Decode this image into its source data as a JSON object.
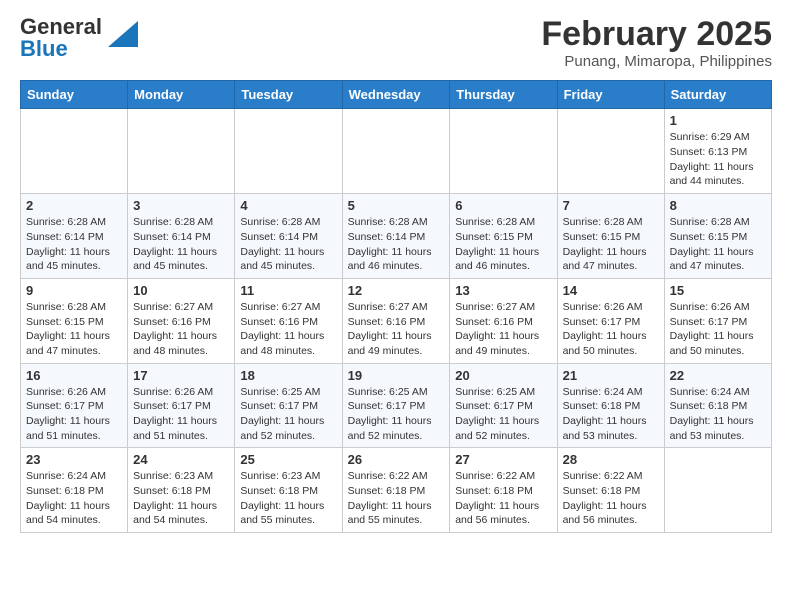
{
  "header": {
    "logo_general": "General",
    "logo_blue": "Blue",
    "title": "February 2025",
    "subtitle": "Punang, Mimaropa, Philippines"
  },
  "days_of_week": [
    "Sunday",
    "Monday",
    "Tuesday",
    "Wednesday",
    "Thursday",
    "Friday",
    "Saturday"
  ],
  "weeks": [
    {
      "days": [
        {
          "num": "",
          "info": ""
        },
        {
          "num": "",
          "info": ""
        },
        {
          "num": "",
          "info": ""
        },
        {
          "num": "",
          "info": ""
        },
        {
          "num": "",
          "info": ""
        },
        {
          "num": "",
          "info": ""
        },
        {
          "num": "1",
          "info": "Sunrise: 6:29 AM\nSunset: 6:13 PM\nDaylight: 11 hours\nand 44 minutes."
        }
      ]
    },
    {
      "days": [
        {
          "num": "2",
          "info": "Sunrise: 6:28 AM\nSunset: 6:14 PM\nDaylight: 11 hours\nand 45 minutes."
        },
        {
          "num": "3",
          "info": "Sunrise: 6:28 AM\nSunset: 6:14 PM\nDaylight: 11 hours\nand 45 minutes."
        },
        {
          "num": "4",
          "info": "Sunrise: 6:28 AM\nSunset: 6:14 PM\nDaylight: 11 hours\nand 45 minutes."
        },
        {
          "num": "5",
          "info": "Sunrise: 6:28 AM\nSunset: 6:14 PM\nDaylight: 11 hours\nand 46 minutes."
        },
        {
          "num": "6",
          "info": "Sunrise: 6:28 AM\nSunset: 6:15 PM\nDaylight: 11 hours\nand 46 minutes."
        },
        {
          "num": "7",
          "info": "Sunrise: 6:28 AM\nSunset: 6:15 PM\nDaylight: 11 hours\nand 47 minutes."
        },
        {
          "num": "8",
          "info": "Sunrise: 6:28 AM\nSunset: 6:15 PM\nDaylight: 11 hours\nand 47 minutes."
        }
      ]
    },
    {
      "days": [
        {
          "num": "9",
          "info": "Sunrise: 6:28 AM\nSunset: 6:15 PM\nDaylight: 11 hours\nand 47 minutes."
        },
        {
          "num": "10",
          "info": "Sunrise: 6:27 AM\nSunset: 6:16 PM\nDaylight: 11 hours\nand 48 minutes."
        },
        {
          "num": "11",
          "info": "Sunrise: 6:27 AM\nSunset: 6:16 PM\nDaylight: 11 hours\nand 48 minutes."
        },
        {
          "num": "12",
          "info": "Sunrise: 6:27 AM\nSunset: 6:16 PM\nDaylight: 11 hours\nand 49 minutes."
        },
        {
          "num": "13",
          "info": "Sunrise: 6:27 AM\nSunset: 6:16 PM\nDaylight: 11 hours\nand 49 minutes."
        },
        {
          "num": "14",
          "info": "Sunrise: 6:26 AM\nSunset: 6:17 PM\nDaylight: 11 hours\nand 50 minutes."
        },
        {
          "num": "15",
          "info": "Sunrise: 6:26 AM\nSunset: 6:17 PM\nDaylight: 11 hours\nand 50 minutes."
        }
      ]
    },
    {
      "days": [
        {
          "num": "16",
          "info": "Sunrise: 6:26 AM\nSunset: 6:17 PM\nDaylight: 11 hours\nand 51 minutes."
        },
        {
          "num": "17",
          "info": "Sunrise: 6:26 AM\nSunset: 6:17 PM\nDaylight: 11 hours\nand 51 minutes."
        },
        {
          "num": "18",
          "info": "Sunrise: 6:25 AM\nSunset: 6:17 PM\nDaylight: 11 hours\nand 52 minutes."
        },
        {
          "num": "19",
          "info": "Sunrise: 6:25 AM\nSunset: 6:17 PM\nDaylight: 11 hours\nand 52 minutes."
        },
        {
          "num": "20",
          "info": "Sunrise: 6:25 AM\nSunset: 6:17 PM\nDaylight: 11 hours\nand 52 minutes."
        },
        {
          "num": "21",
          "info": "Sunrise: 6:24 AM\nSunset: 6:18 PM\nDaylight: 11 hours\nand 53 minutes."
        },
        {
          "num": "22",
          "info": "Sunrise: 6:24 AM\nSunset: 6:18 PM\nDaylight: 11 hours\nand 53 minutes."
        }
      ]
    },
    {
      "days": [
        {
          "num": "23",
          "info": "Sunrise: 6:24 AM\nSunset: 6:18 PM\nDaylight: 11 hours\nand 54 minutes."
        },
        {
          "num": "24",
          "info": "Sunrise: 6:23 AM\nSunset: 6:18 PM\nDaylight: 11 hours\nand 54 minutes."
        },
        {
          "num": "25",
          "info": "Sunrise: 6:23 AM\nSunset: 6:18 PM\nDaylight: 11 hours\nand 55 minutes."
        },
        {
          "num": "26",
          "info": "Sunrise: 6:22 AM\nSunset: 6:18 PM\nDaylight: 11 hours\nand 55 minutes."
        },
        {
          "num": "27",
          "info": "Sunrise: 6:22 AM\nSunset: 6:18 PM\nDaylight: 11 hours\nand 56 minutes."
        },
        {
          "num": "28",
          "info": "Sunrise: 6:22 AM\nSunset: 6:18 PM\nDaylight: 11 hours\nand 56 minutes."
        },
        {
          "num": "",
          "info": ""
        }
      ]
    }
  ]
}
